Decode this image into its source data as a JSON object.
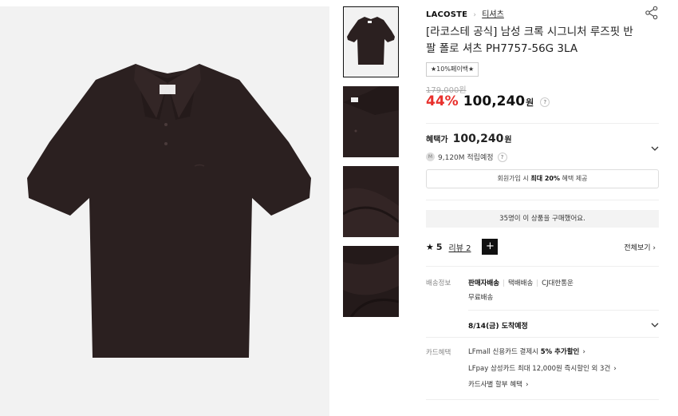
{
  "product": {
    "brand": "LACOSTE",
    "category": "티셔츠",
    "title": "[라코스테 공식] 남성 크록 시그니처 루즈핏 반팔 폴로 셔츠 PH7757-56G 3LA",
    "badge": "★10%페이백★",
    "original_price": "179,000원",
    "discount": "44%",
    "price": "100,240",
    "won": "원",
    "help": "?"
  },
  "benefit": {
    "label": "혜택가",
    "price": "100,240",
    "won": "원",
    "points_icon": "M",
    "points": "9,120M 적립예정",
    "help": "?",
    "join_pre": "회원가입 시 ",
    "join_bold": "최대 20%",
    "join_post": " 혜택 제공"
  },
  "buyers": "35명이 이 상품을 구매했어요.",
  "review": {
    "star": "★",
    "score": "5",
    "link": "리뷰 2",
    "add": "+",
    "all": "전체보기"
  },
  "shipping": {
    "label": "배송정보",
    "type": "판매자배송",
    "method": "택배배송",
    "carrier": "CJ대한통운",
    "fee": "무료배송",
    "arrival": "8/14(금) 도착예정"
  },
  "card": {
    "label": "카드혜택",
    "line1_pre": "LFmall 신용카드 결제시 ",
    "line1_bold": "5% 추가할인",
    "line2": "LFpay 삼성카드 최대 12,000원 즉시할인 외 3건",
    "line3": "카드사별 할부 혜택"
  },
  "colors": {
    "shirt": "#2b2020",
    "accent_red": "#e8302c",
    "background": "#f2f2f2"
  }
}
